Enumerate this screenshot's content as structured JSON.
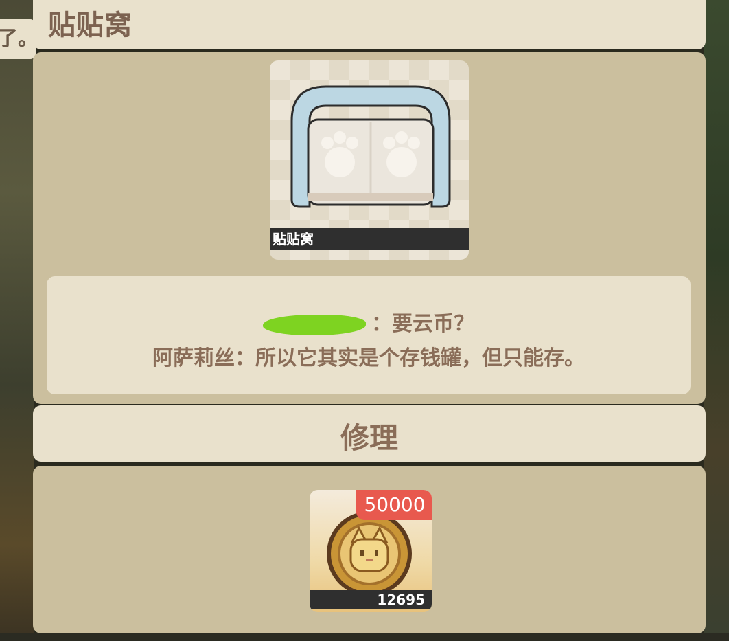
{
  "background": {
    "speech_fragment": "了。"
  },
  "title": "贴贴窝",
  "item": {
    "name": "贴贴窝",
    "icon": "paw-sofa-icon"
  },
  "dialog": {
    "line1_redacted": true,
    "line1": "：要云币？",
    "line2": "阿萨莉丝：所以它其实是个存钱罐，但只能存。"
  },
  "repair": {
    "label": "修理",
    "price": "50000",
    "owned": "12695",
    "currency_icon": "cat-coin-icon"
  },
  "colors": {
    "panel_light": "#e9e1cc",
    "panel_dark": "#cbbf9e",
    "text": "#8a6d58",
    "badge": "#e8594e",
    "redaction": "#7ed321"
  }
}
